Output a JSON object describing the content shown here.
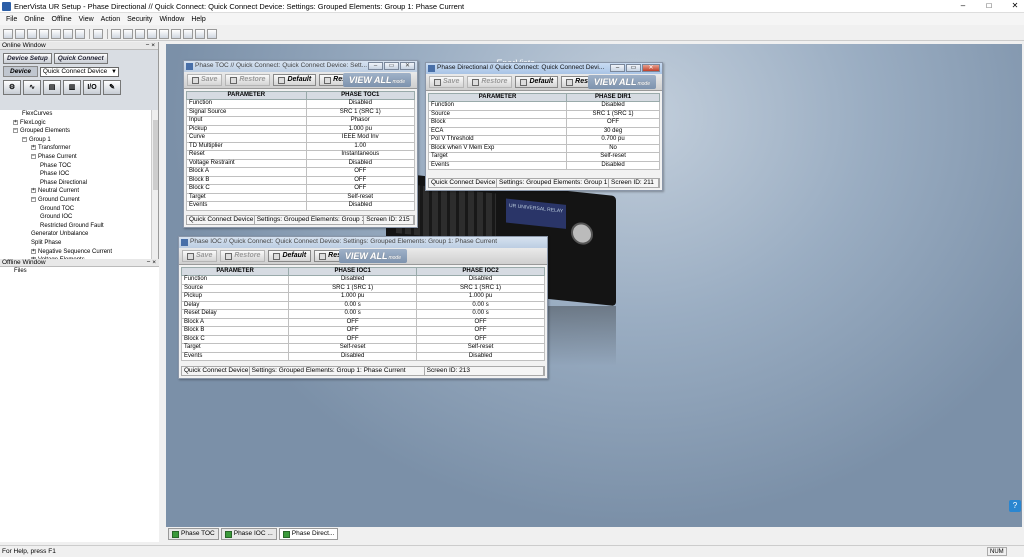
{
  "app": {
    "title": "EnerVista UR Setup  - Phase Directional // Quick Connect: Quick Connect Device: Settings: Grouped Elements: Group 1: Phase Current",
    "min": "–",
    "max": "□",
    "close": "✕"
  },
  "menu": [
    "File",
    "Online",
    "Offline",
    "View",
    "Action",
    "Security",
    "Window",
    "Help"
  ],
  "online_window": {
    "title": "Online Window",
    "pin": "− ×",
    "device_setup": "Device Setup",
    "quick_connect": "Quick Connect",
    "device_label": "Device",
    "device_value": "Quick Connect Device",
    "io_label": "I/O",
    "tree": [
      {
        "label": "FlexCurves",
        "indent": 2,
        "pm": ""
      },
      {
        "label": "FlexLogic",
        "indent": 1,
        "pm": "+"
      },
      {
        "label": "Grouped Elements",
        "indent": 1,
        "pm": "−"
      },
      {
        "label": "Group 1",
        "indent": 2,
        "pm": "−"
      },
      {
        "label": "Transformer",
        "indent": 3,
        "pm": "+"
      },
      {
        "label": "Phase Current",
        "indent": 3,
        "pm": "−"
      },
      {
        "label": "Phase TOC",
        "indent": 4,
        "pm": ""
      },
      {
        "label": "Phase IOC",
        "indent": 4,
        "pm": ""
      },
      {
        "label": "Phase Directional",
        "indent": 4,
        "pm": ""
      },
      {
        "label": "Neutral Current",
        "indent": 3,
        "pm": "+"
      },
      {
        "label": "Ground Current",
        "indent": 3,
        "pm": "−"
      },
      {
        "label": "Ground TOC",
        "indent": 4,
        "pm": ""
      },
      {
        "label": "Ground IOC",
        "indent": 4,
        "pm": ""
      },
      {
        "label": "Restricted Ground Fault",
        "indent": 4,
        "pm": ""
      },
      {
        "label": "Generator Unbalance",
        "indent": 3,
        "pm": ""
      },
      {
        "label": "Split Phase",
        "indent": 3,
        "pm": ""
      },
      {
        "label": "Negative Sequence Current",
        "indent": 3,
        "pm": "+"
      },
      {
        "label": "Voltage Elements",
        "indent": 3,
        "pm": "+"
      }
    ]
  },
  "offline_window": {
    "title": "Offline Window",
    "pin": "− ×",
    "files": "Files"
  },
  "brand_text": "EnerVista",
  "relay_text": "UR UNIVERSAL RELAY",
  "toolbar_buttons": {
    "save": "Save",
    "restore": "Restore",
    "default": "Default",
    "reset": "Reset",
    "view_all": "VIEW ALL",
    "mode": "mode"
  },
  "win_toc": {
    "title": "Phase TOC // Quick Connect: Quick Connect Device: Sett...",
    "headers": [
      "PARAMETER",
      "PHASE TOC1"
    ],
    "rows": [
      [
        "Function",
        "Disabled"
      ],
      [
        "Signal Source",
        "SRC 1 (SRC 1)"
      ],
      [
        "Input",
        "Phasor"
      ],
      [
        "Pickup",
        "1.000 pu"
      ],
      [
        "Curve",
        "IEEE Mod Inv"
      ],
      [
        "TD Multiplier",
        "1.00"
      ],
      [
        "Reset",
        "Instantaneous"
      ],
      [
        "Voltage Restraint",
        "Disabled"
      ],
      [
        "Block A",
        "OFF"
      ],
      [
        "Block B",
        "OFF"
      ],
      [
        "Block C",
        "OFF"
      ],
      [
        "Target",
        "Self-reset"
      ],
      [
        "Events",
        "Disabled"
      ]
    ],
    "status": [
      "Quick Connect Device",
      "Settings: Grouped Elements: Group 1: I",
      "Screen ID: 215"
    ]
  },
  "win_dir": {
    "title": "Phase Directional // Quick Connect: Quick Connect Devi...",
    "headers": [
      "PARAMETER",
      "PHASE DIR1"
    ],
    "rows": [
      [
        "Function",
        "Disabled"
      ],
      [
        "Source",
        "SRC 1 (SRC 1)"
      ],
      [
        "Block",
        "OFF"
      ],
      [
        "ECA",
        "30 deg"
      ],
      [
        "Pol V Threshold",
        "0.700 pu"
      ],
      [
        "Block when V Mem Exp",
        "No"
      ],
      [
        "Target",
        "Self-reset"
      ],
      [
        "Events",
        "Disabled"
      ]
    ],
    "status": [
      "Quick Connect Device",
      "Settings: Grouped Elements: Group 1: F",
      "Screen ID: 211"
    ]
  },
  "win_ioc": {
    "title": "Phase IOC // Quick Connect: Quick Connect Device: Settings: Grouped Elements: Group 1: Phase Current",
    "headers": [
      "PARAMETER",
      "PHASE IOC1",
      "PHASE IOC2"
    ],
    "rows": [
      [
        "Function",
        "Disabled",
        "Disabled"
      ],
      [
        "Source",
        "SRC 1 (SRC 1)",
        "SRC 1 (SRC 1)"
      ],
      [
        "Pickup",
        "1.000 pu",
        "1.000 pu"
      ],
      [
        "Delay",
        "0.00 s",
        "0.00 s"
      ],
      [
        "Reset Delay",
        "0.00 s",
        "0.00 s"
      ],
      [
        "Block A",
        "OFF",
        "OFF"
      ],
      [
        "Block B",
        "OFF",
        "OFF"
      ],
      [
        "Block C",
        "OFF",
        "OFF"
      ],
      [
        "Target",
        "Self-reset",
        "Self-reset"
      ],
      [
        "Events",
        "Disabled",
        "Disabled"
      ]
    ],
    "status": [
      "Quick Connect Device",
      "Settings: Grouped Elements: Group 1: Phase Current",
      "Screen ID: 213"
    ]
  },
  "tabs": [
    "Phase TOC",
    "Phase IOC ...",
    "Phase Direct..."
  ],
  "statusbar": {
    "help": "For Help, press F1",
    "num": "NUM"
  }
}
